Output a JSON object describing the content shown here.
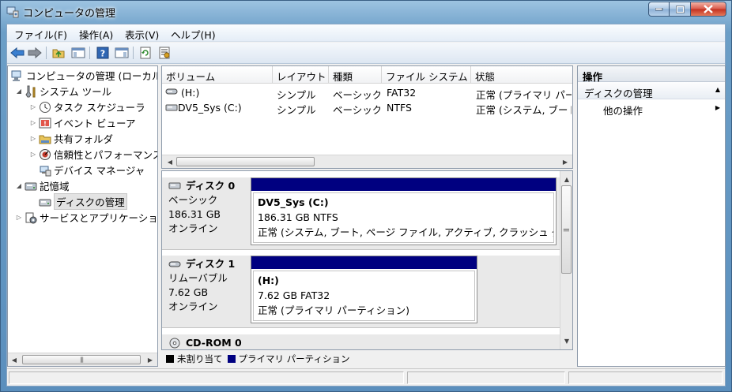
{
  "window": {
    "title": "コンピュータの管理"
  },
  "menu": [
    "ファイル(F)",
    "操作(A)",
    "表示(V)",
    "ヘルプ(H)"
  ],
  "tree": {
    "root": "コンピュータの管理 (ローカル)",
    "system_tools": "システム ツール",
    "task_scheduler": "タスク スケジューラ",
    "event_viewer": "イベント ビューア",
    "shared_folders": "共有フォルダ",
    "reliability": "信頼性とパフォーマンス",
    "device_manager": "デバイス マネージャ",
    "storage": "記憶域",
    "disk_management": "ディスクの管理",
    "services": "サービスとアプリケーション"
  },
  "volumes": {
    "headers": [
      "ボリューム",
      "レイアウト",
      "種類",
      "ファイル システム",
      "状態"
    ],
    "rows": [
      [
        "(H:)",
        "シンプル",
        "ベーシック",
        "FAT32",
        "正常 (プライマリ パーティション)"
      ],
      [
        "DV5_Sys (C:)",
        "シンプル",
        "ベーシック",
        "NTFS",
        "正常 (システム, ブート, ページ ファイル, アクティブ, クラッシュ ダンプ, プライマリ パーティション)"
      ]
    ]
  },
  "disks": [
    {
      "name": "ディスク 0",
      "type": "ベーシック",
      "size": "186.31 GB",
      "status": "オンライン",
      "partition": {
        "label": "DV5_Sys  (C:)",
        "size_fs": "186.31 GB NTFS",
        "status": "正常 (システム, ブート, ページ ファイル, アクティブ, クラッシュ ダンプ)"
      }
    },
    {
      "name": "ディスク 1",
      "type": "リムーバブル",
      "size": "7.62 GB",
      "status": "オンライン",
      "partition": {
        "label": "(H:)",
        "size_fs": "7.62 GB FAT32",
        "status": "正常 (プライマリ パーティション)"
      }
    }
  ],
  "cdrom": {
    "name": "CD-ROM 0"
  },
  "legend": {
    "unallocated": "未割り当て",
    "primary": "プライマリ パーティション"
  },
  "actions": {
    "header": "操作",
    "section": "ディスクの管理",
    "more": "他の操作"
  },
  "colors": {
    "primary_partition": "#000080",
    "unallocated": "#000000"
  }
}
